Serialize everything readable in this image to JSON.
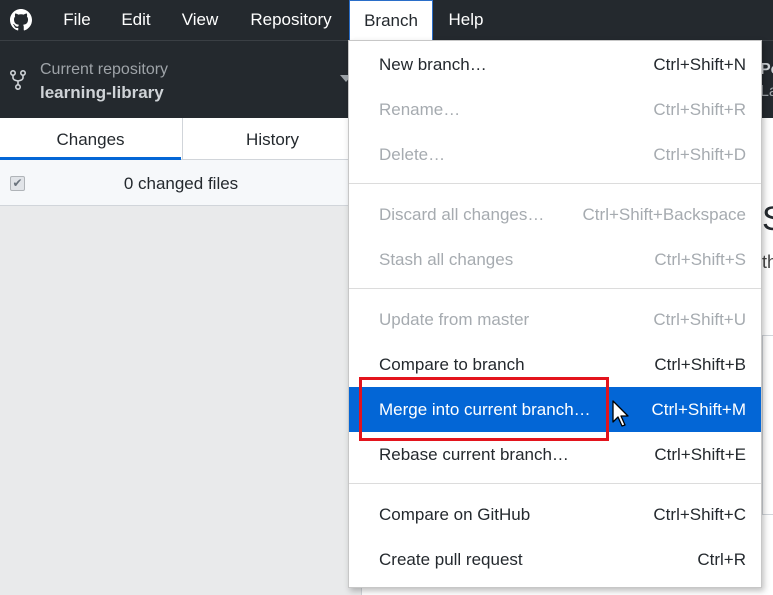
{
  "menubar": {
    "items": [
      "File",
      "Edit",
      "View",
      "Repository",
      "Branch",
      "Help"
    ],
    "active": "Branch"
  },
  "toolbar": {
    "repo_caption": "Current repository",
    "repo_name": "learning-library",
    "peek_top": "Po",
    "peek_bottom": "La"
  },
  "tabs": {
    "changes": "Changes",
    "history": "History"
  },
  "changes": {
    "count_text": "0 changed files",
    "checkbox_glyph": "✔"
  },
  "right_peek": {
    "line1": "S",
    "line2": "th"
  },
  "branch_menu": {
    "groups": [
      [
        {
          "label": "New branch…",
          "shortcut": "Ctrl+Shift+N",
          "enabled": true
        },
        {
          "label": "Rename…",
          "shortcut": "Ctrl+Shift+R",
          "enabled": false
        },
        {
          "label": "Delete…",
          "shortcut": "Ctrl+Shift+D",
          "enabled": false
        }
      ],
      [
        {
          "label": "Discard all changes…",
          "shortcut": "Ctrl+Shift+Backspace",
          "enabled": false
        },
        {
          "label": "Stash all changes",
          "shortcut": "Ctrl+Shift+S",
          "enabled": false
        }
      ],
      [
        {
          "label": "Update from master",
          "shortcut": "Ctrl+Shift+U",
          "enabled": false
        },
        {
          "label": "Compare to branch",
          "shortcut": "Ctrl+Shift+B",
          "enabled": true
        },
        {
          "label": "Merge into current branch…",
          "shortcut": "Ctrl+Shift+M",
          "enabled": true,
          "highlighted": true
        },
        {
          "label": "Rebase current branch…",
          "shortcut": "Ctrl+Shift+E",
          "enabled": true
        }
      ],
      [
        {
          "label": "Compare on GitHub",
          "shortcut": "Ctrl+Shift+C",
          "enabled": true
        },
        {
          "label": "Create pull request",
          "shortcut": "Ctrl+R",
          "enabled": true
        }
      ]
    ]
  },
  "colors": {
    "menubar_bg": "#24292e",
    "highlight": "#0366d6",
    "annotation_red": "#e3141d"
  }
}
